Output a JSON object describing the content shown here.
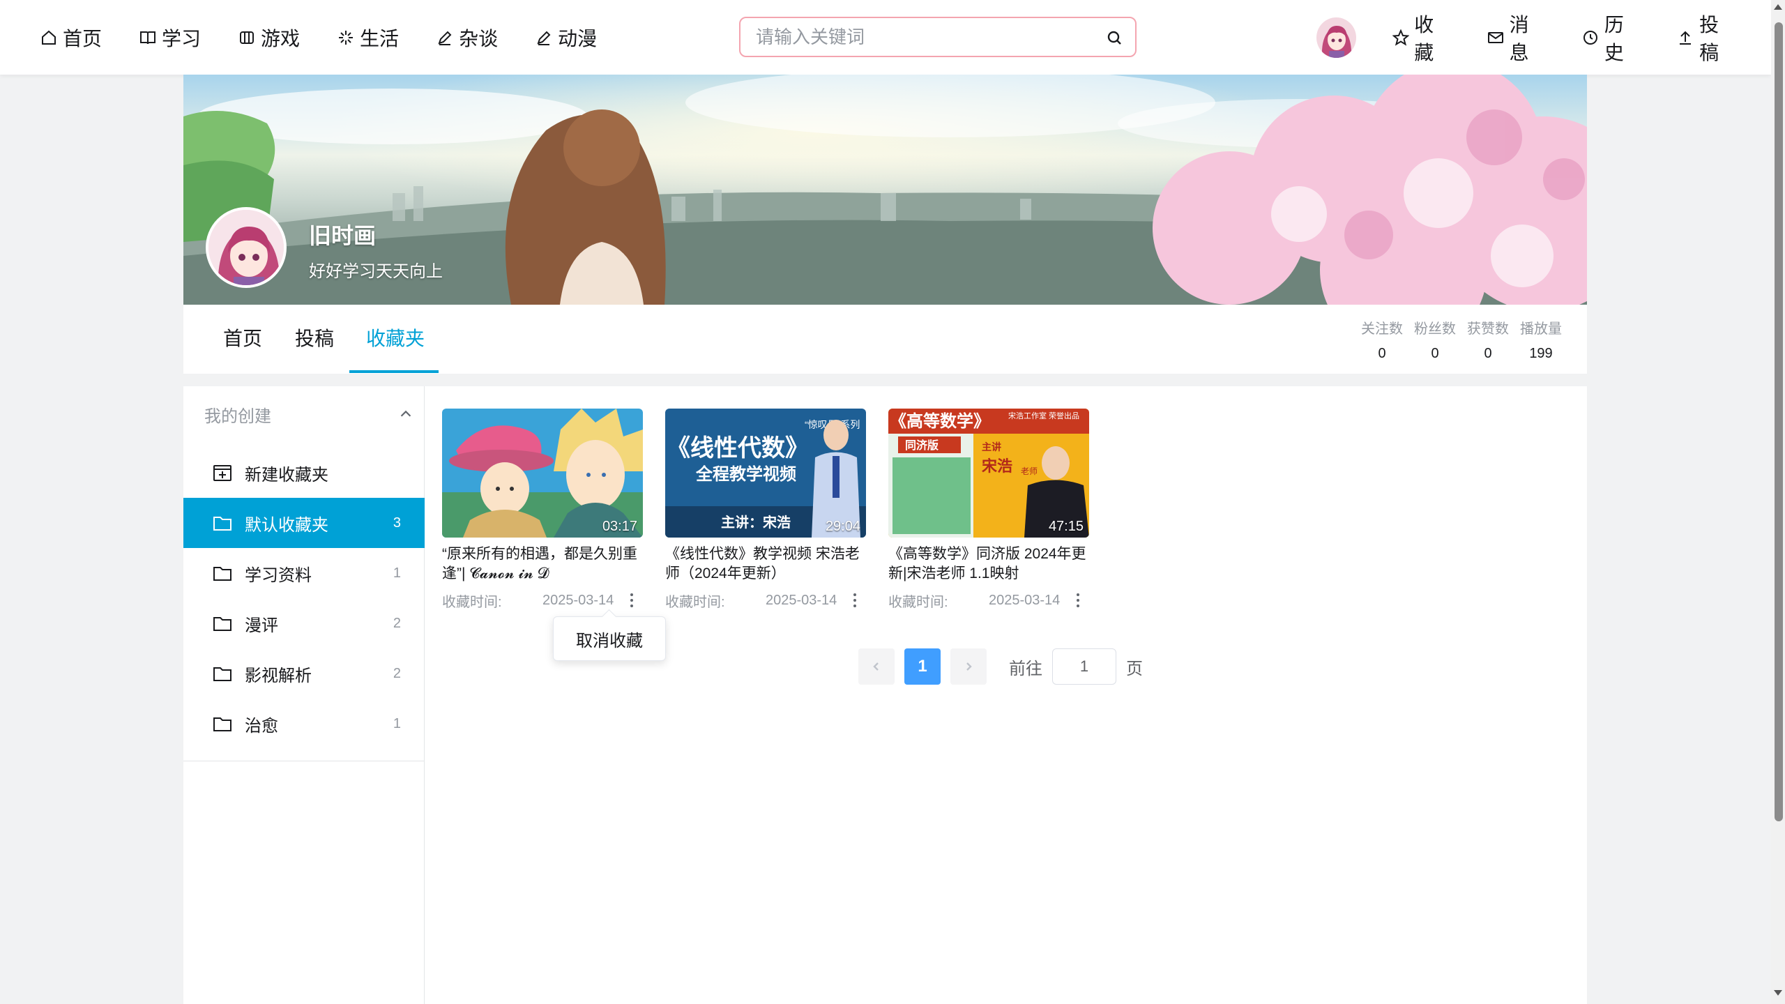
{
  "nav": {
    "left": [
      {
        "label": "首页",
        "icon": "home-icon"
      },
      {
        "label": "学习",
        "icon": "book-icon"
      },
      {
        "label": "游戏",
        "icon": "gamepad-icon"
      },
      {
        "label": "生活",
        "icon": "sparkle-icon"
      },
      {
        "label": "杂谈",
        "icon": "pen-icon"
      },
      {
        "label": "动漫",
        "icon": "pen-icon"
      }
    ],
    "search_placeholder": "请输入关键词",
    "right": [
      {
        "label": "收藏",
        "icon": "star-icon"
      },
      {
        "label": "消息",
        "icon": "mail-icon"
      },
      {
        "label": "历史",
        "icon": "clock-icon"
      },
      {
        "label": "投稿",
        "icon": "upload-icon"
      }
    ]
  },
  "profile": {
    "name": "旧时画",
    "signature": "好好学习天天向上"
  },
  "tabs": [
    "首页",
    "投稿",
    "收藏夹"
  ],
  "active_tab": "收藏夹",
  "stats": [
    {
      "label": "关注数",
      "value": "0"
    },
    {
      "label": "粉丝数",
      "value": "0"
    },
    {
      "label": "获赞数",
      "value": "0"
    },
    {
      "label": "播放量",
      "value": "199"
    }
  ],
  "sidebar": {
    "header": "我的创建",
    "new_label": "新建收藏夹",
    "folders": [
      {
        "label": "默认收藏夹",
        "count": "3",
        "active": true
      },
      {
        "label": "学习资料",
        "count": "1"
      },
      {
        "label": "漫评",
        "count": "2"
      },
      {
        "label": "影视解析",
        "count": "2"
      },
      {
        "label": "治愈",
        "count": "1"
      }
    ]
  },
  "videos": [
    {
      "title": "“原来所有的相遇，都是久别重逢”| 𝓒𝓪𝓷𝓸𝓷 𝓲𝓷 𝓓",
      "duration": "03:17",
      "time_label": "收藏时间:",
      "date": "2025-03-14"
    },
    {
      "title": "《线性代数》教学视频 宋浩老师（2024年更新）",
      "duration": "29:04",
      "time_label": "收藏时间:",
      "date": "2025-03-14"
    },
    {
      "title": "《高等数学》同济版 2024年更新|宋浩老师 1.1映射",
      "duration": "47:15",
      "time_label": "收藏时间:",
      "date": "2025-03-14"
    }
  ],
  "thumb_text": {
    "v2_series": "“惊叹号”系列",
    "v2_main": "《线性代数》",
    "v2_sub": "全程教学视频",
    "v2_teacher": "主讲：宋浩",
    "v3_main": "《高等数学》",
    "v3_studio": "宋浩工作室 荣誉出品",
    "v3_edition": "同济版",
    "v3_role": "主讲",
    "v3_teacher": "宋浩",
    "v3_teacher_title": "老师"
  },
  "popup": "取消收藏",
  "pagination": {
    "current": "1",
    "goto_label": "前往",
    "goto_value": "1",
    "page_label": "页"
  }
}
